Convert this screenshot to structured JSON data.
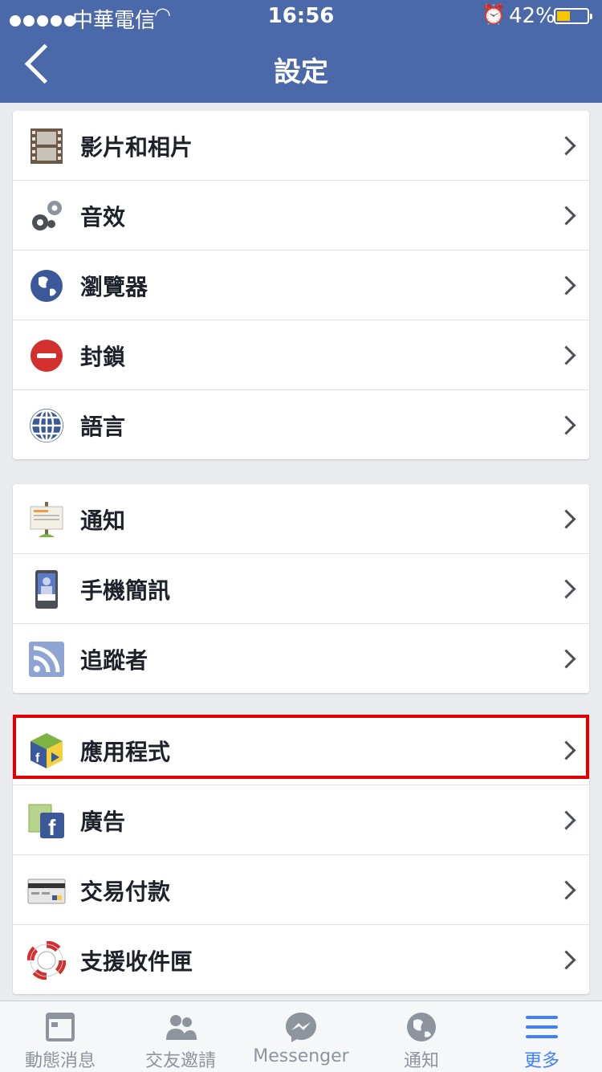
{
  "status_bar": {
    "carrier": "中華電信",
    "time": "16:56",
    "battery": "42%",
    "battery_level": 0.42
  },
  "nav": {
    "title": "設定"
  },
  "groups": [
    {
      "items": [
        {
          "label": "影片和相片",
          "icon": "film-icon"
        },
        {
          "label": "音效",
          "icon": "gears-icon"
        },
        {
          "label": "瀏覽器",
          "icon": "globe-americas-icon"
        },
        {
          "label": "封鎖",
          "icon": "block-icon"
        },
        {
          "label": "語言",
          "icon": "globe-grid-icon"
        }
      ]
    },
    {
      "items": [
        {
          "label": "通知",
          "icon": "signboard-icon"
        },
        {
          "label": "手機簡訊",
          "icon": "phone-icon"
        },
        {
          "label": "追蹤者",
          "icon": "rss-icon"
        }
      ]
    },
    {
      "items": [
        {
          "label": "應用程式",
          "icon": "apps-cube-icon",
          "highlighted": true
        },
        {
          "label": "廣告",
          "icon": "ads-icon"
        },
        {
          "label": "交易付款",
          "icon": "credit-card-icon"
        },
        {
          "label": "支援收件匣",
          "icon": "lifebuoy-icon"
        }
      ]
    }
  ],
  "tabs": [
    {
      "label": "動態消息",
      "icon": "news-feed-icon"
    },
    {
      "label": "交友邀請",
      "icon": "friends-icon"
    },
    {
      "label": "Messenger",
      "icon": "messenger-icon"
    },
    {
      "label": "通知",
      "icon": "globe-notifications-icon"
    },
    {
      "label": "更多",
      "icon": "menu-icon",
      "active": true
    }
  ],
  "colors": {
    "brand": "#4b69a8",
    "highlight": "#e00000",
    "active_tab": "#4080ff"
  }
}
